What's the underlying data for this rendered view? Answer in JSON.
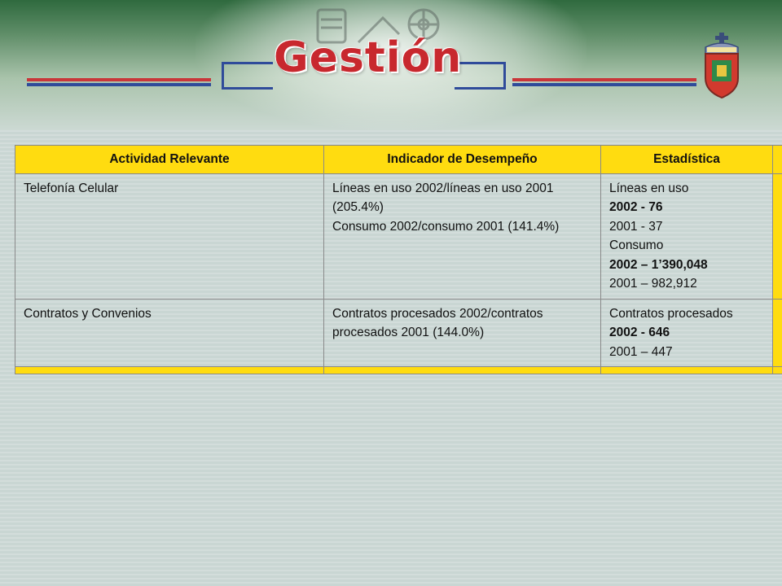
{
  "header": {
    "title": "Gestión",
    "colors": {
      "title": "#c8282e",
      "stripe_red": "#c9363a",
      "stripe_blue": "#2f4b9a",
      "table_header": "#ffdc10"
    },
    "icons": [
      "film-reel-icon",
      "university-crest-icon"
    ]
  },
  "table": {
    "columns": [
      "Actividad Relevante",
      "Indicador de Desempeño",
      "Estadística"
    ],
    "rows": [
      {
        "actividad": "Telefonía Celular",
        "indicador": [
          "Líneas en uso 2002/líneas en uso 2001 (205.4%)",
          "Consumo 2002/consumo 2001 (141.4%)"
        ],
        "estadistica": [
          {
            "text": "Líneas en uso",
            "bold": false
          },
          {
            "text": "2002 - 76",
            "bold": true
          },
          {
            "text": "2001 - 37",
            "bold": false
          },
          {
            "text": "Consumo",
            "bold": false
          },
          {
            "text": "2002 – 1’390,048",
            "bold": true
          },
          {
            "text": "2001 – 982,912",
            "bold": false
          }
        ]
      },
      {
        "actividad": "Contratos y Convenios",
        "indicador": [
          "Contratos procesados 2002/contratos procesados 2001 (144.0%)"
        ],
        "estadistica": [
          {
            "text": "Contratos procesados",
            "bold": false
          },
          {
            "text": "2002 - 646",
            "bold": true
          },
          {
            "text": "2001 – 447",
            "bold": false
          }
        ]
      }
    ]
  }
}
